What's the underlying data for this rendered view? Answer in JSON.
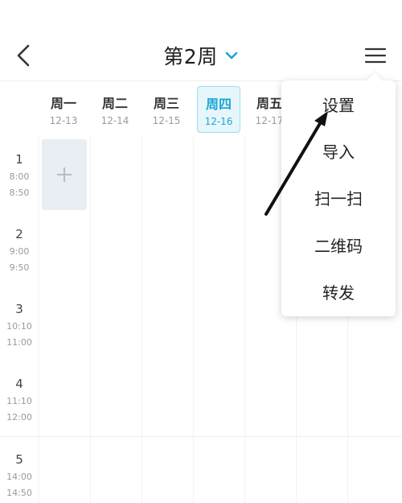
{
  "header": {
    "title": "第2周",
    "back_icon": "chevron-left-icon",
    "dropdown_icon": "chevron-down-icon",
    "menu_icon": "hamburger-menu-icon",
    "accent_color": "#1aa6d6"
  },
  "week": {
    "days": [
      {
        "name": "周一",
        "date": "12-13",
        "today": false
      },
      {
        "name": "周二",
        "date": "12-14",
        "today": false
      },
      {
        "name": "周三",
        "date": "12-15",
        "today": false
      },
      {
        "name": "周四",
        "date": "12-16",
        "today": true
      },
      {
        "name": "周五",
        "date": "12-17",
        "today": false
      }
    ]
  },
  "periods": [
    {
      "num": "1",
      "start": "8:00",
      "end": "8:50"
    },
    {
      "num": "2",
      "start": "9:00",
      "end": "9:50"
    },
    {
      "num": "3",
      "start": "10:10",
      "end": "11:00"
    },
    {
      "num": "4",
      "start": "11:10",
      "end": "12:00"
    },
    {
      "num": "5",
      "start": "14:00",
      "end": "14:50"
    }
  ],
  "add_cell": {
    "icon": "plus-icon"
  },
  "menu": {
    "items": [
      "设置",
      "导入",
      "扫一扫",
      "二维码",
      "转发"
    ]
  }
}
